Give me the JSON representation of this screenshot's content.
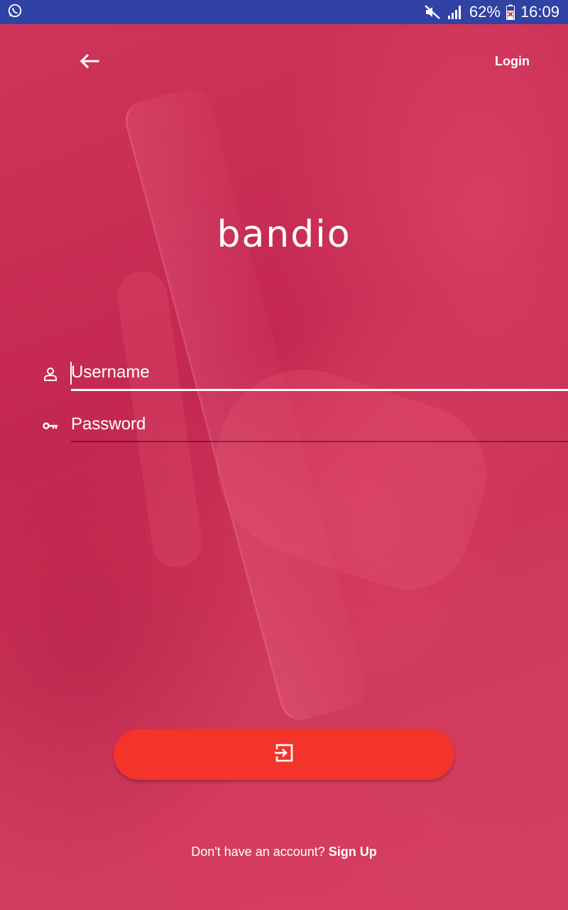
{
  "status_bar": {
    "battery_percent": "62%",
    "time": "16:09",
    "icons": [
      "whatsapp-icon",
      "mute-icon",
      "signal-icon",
      "battery-icon"
    ]
  },
  "nav": {
    "back_icon": "arrow-left-icon",
    "login_label": "Login"
  },
  "brand": {
    "logo_text": "bandio"
  },
  "form": {
    "username": {
      "placeholder": "Username",
      "value": "",
      "icon": "person-icon"
    },
    "password": {
      "placeholder": "Password",
      "value": "",
      "icon": "key-icon"
    },
    "submit_icon": "login-enter-icon"
  },
  "footer": {
    "prompt": "Don't have an account?",
    "signup_label": "Sign Up"
  },
  "colors": {
    "status_bar": "#3042a3",
    "background": "#c8294f",
    "button": "#f2342b",
    "text": "#ffffff"
  }
}
